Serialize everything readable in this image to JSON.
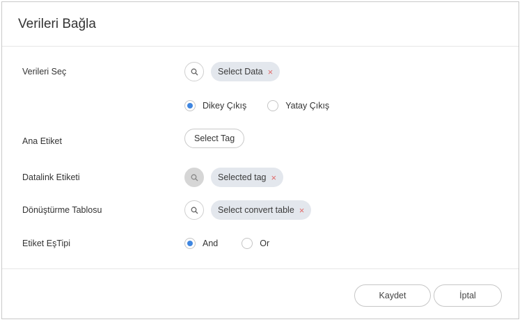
{
  "dialog": {
    "title": "Verileri Bağla"
  },
  "select_data": {
    "label": "Verileri Seç",
    "chip_label": "Select Data",
    "remove_glyph": "×",
    "search_icon": "search-icon"
  },
  "output_direction": {
    "options": [
      {
        "label": "Dikey Çıkış",
        "selected": true
      },
      {
        "label": "Yatay Çıkış",
        "selected": false
      }
    ]
  },
  "main_tag": {
    "label": "Ana Etiket",
    "button_label": "Select Tag"
  },
  "datalink_tag": {
    "label": "Datalink Etiketi",
    "chip_label": "Selected tag",
    "remove_glyph": "×",
    "search_icon": "search-icon"
  },
  "convert_table": {
    "label": "Dönüştürme Tablosu",
    "chip_label": "Select convert table",
    "remove_glyph": "×",
    "search_icon": "search-icon"
  },
  "tag_match_type": {
    "label": "Etiket EşTipi",
    "options": [
      {
        "label": "And",
        "selected": true
      },
      {
        "label": "Or",
        "selected": false
      }
    ]
  },
  "footer": {
    "save_label": "Kaydet",
    "cancel_label": "İptal"
  },
  "colors": {
    "accent": "#3f86e0",
    "chip_bg": "#e3e7ed",
    "remove": "#e06a6a"
  }
}
